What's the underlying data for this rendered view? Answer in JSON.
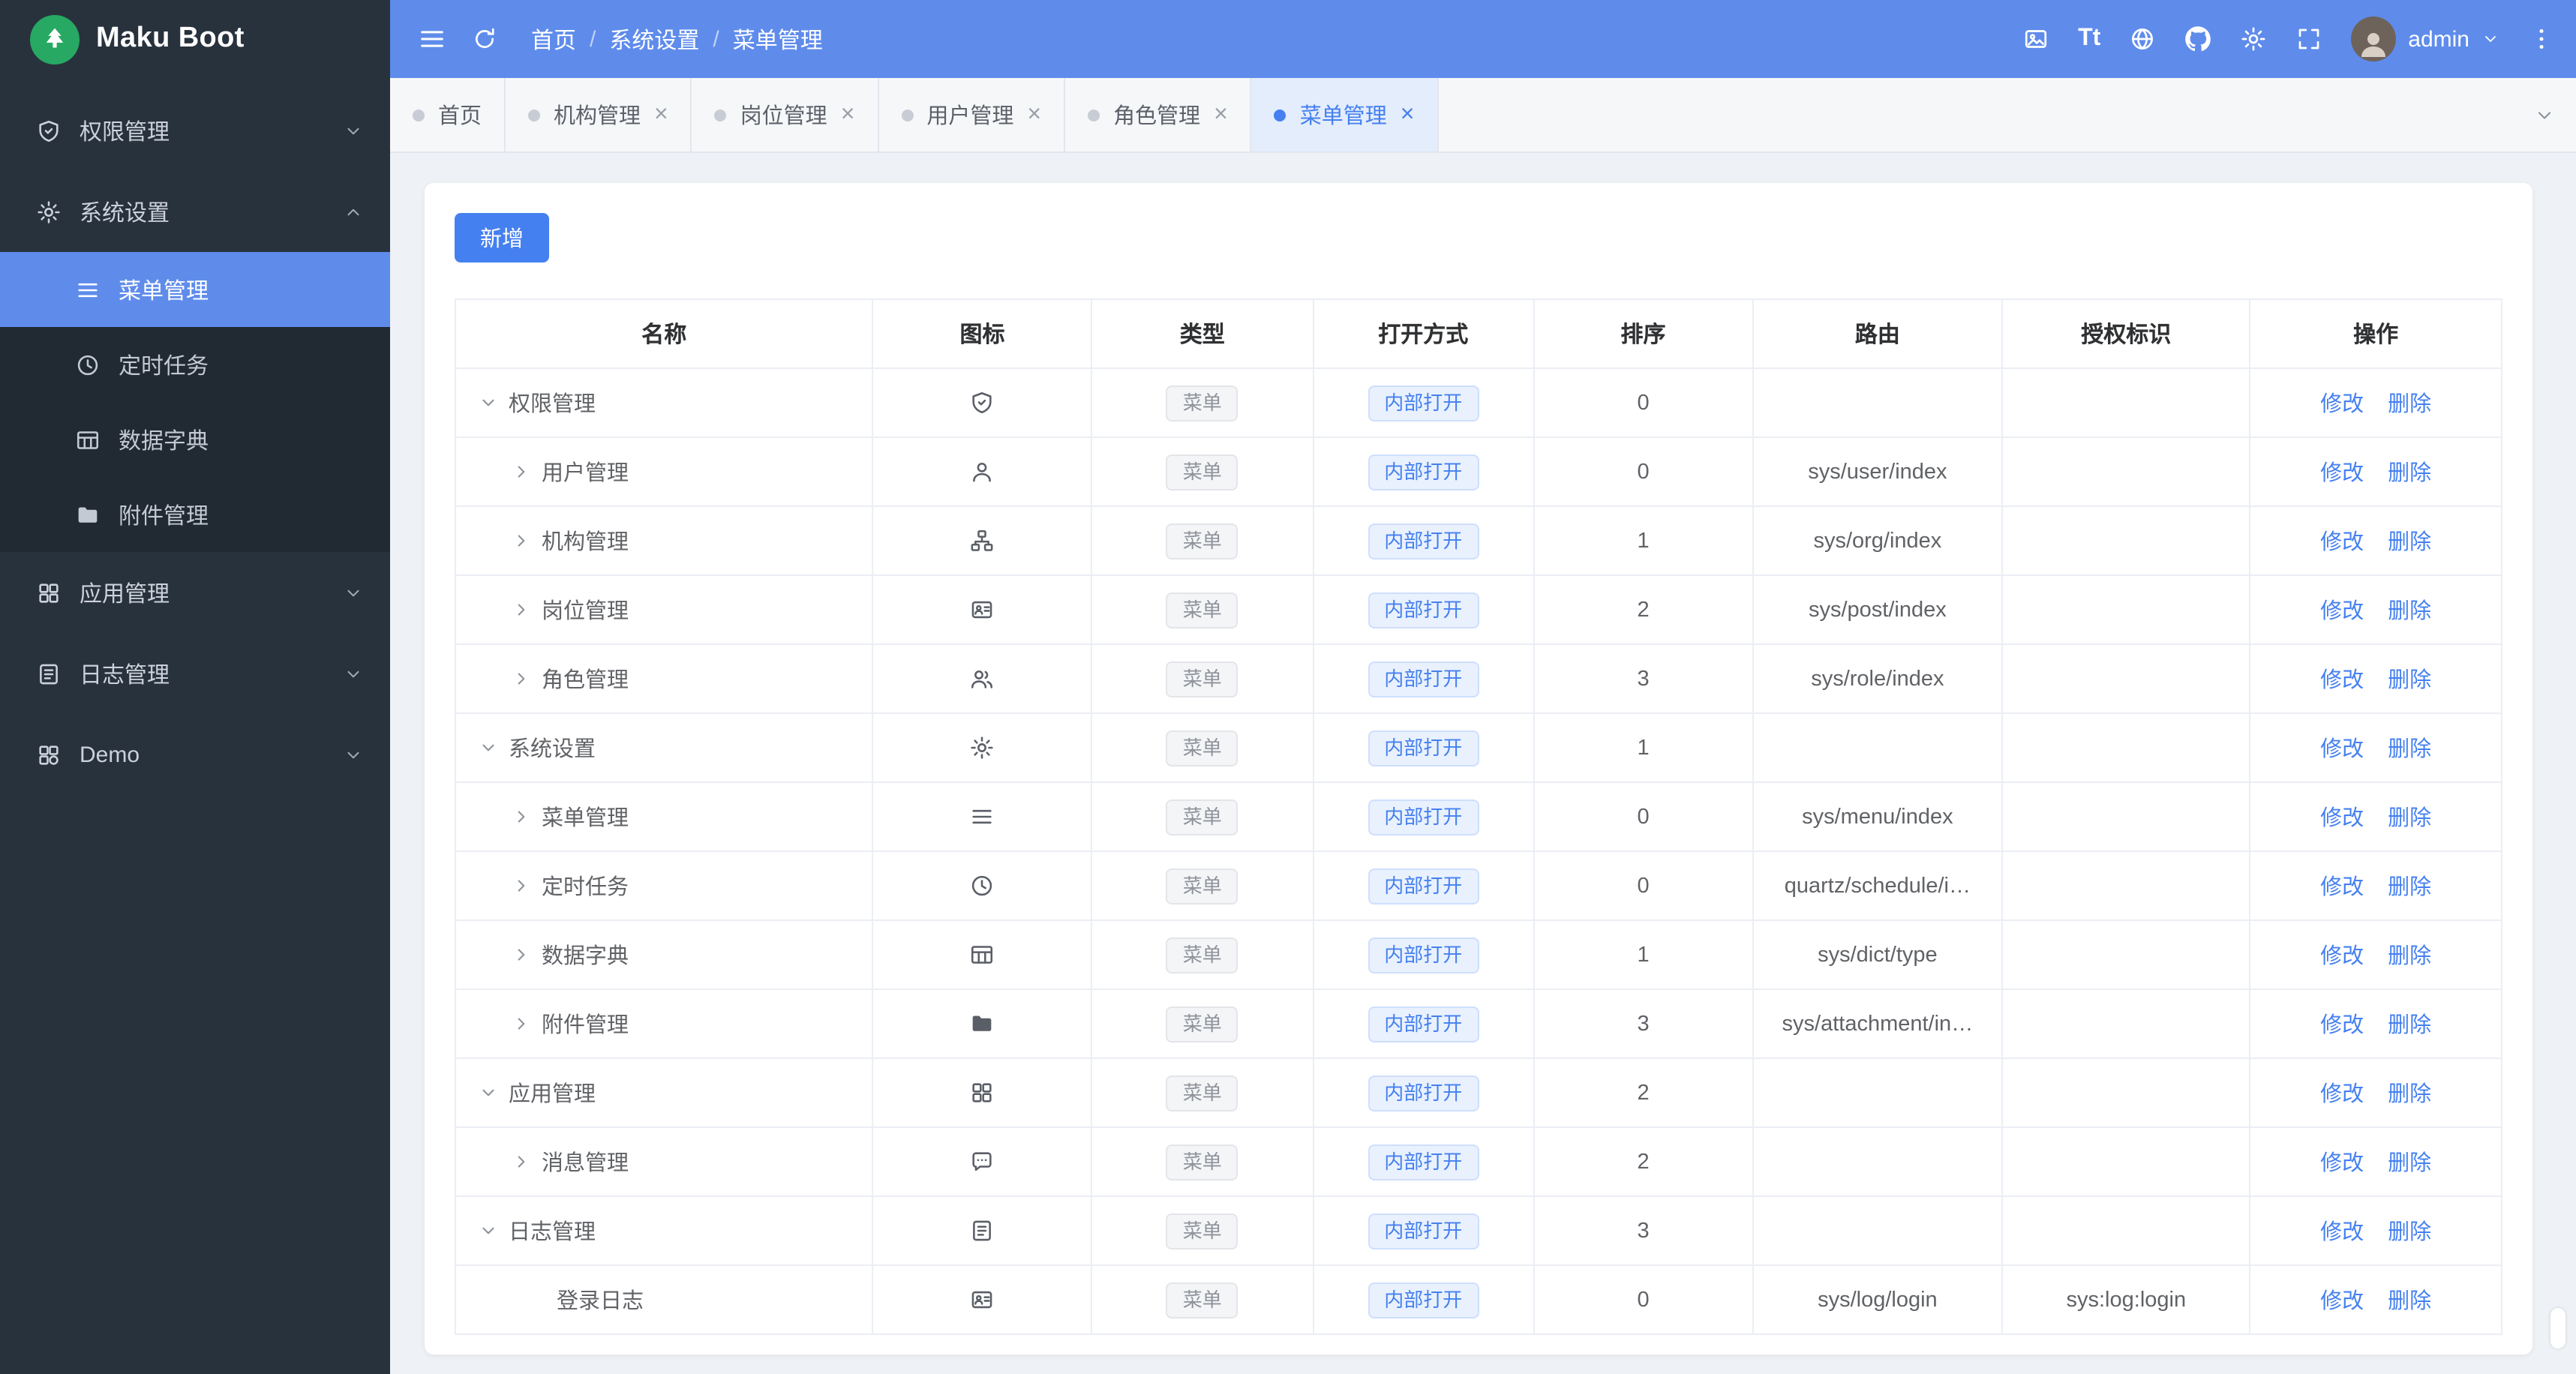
{
  "colors": {
    "header_bg": "#5f8ceb",
    "sidebar_bg": "#28323d",
    "sidebar_sub_bg": "#212a33",
    "sidebar_active_bg": "#5f8ceb",
    "primary": "#4580f0",
    "logo_green": "#27a863",
    "page_bg": "#eef1f5",
    "active_tab_bg": "#e3edfc",
    "tag_info_bg": "#f4f5f7",
    "tag_info_text": "#8f939b",
    "tag_primary_bg": "#e9f1fe",
    "table_border": "#ebeef5"
  },
  "sidebar": {
    "logo_title": "Maku Boot",
    "items": [
      {
        "label": "权限管理",
        "icon": "shield-icon",
        "expanded": false
      },
      {
        "label": "系统设置",
        "icon": "gear-icon",
        "expanded": true,
        "children": [
          {
            "label": "菜单管理",
            "icon": "menu-icon",
            "active": true
          },
          {
            "label": "定时任务",
            "icon": "clock-icon",
            "active": false
          },
          {
            "label": "数据字典",
            "icon": "table-icon",
            "active": false
          },
          {
            "label": "附件管理",
            "icon": "folder-icon",
            "active": false
          }
        ]
      },
      {
        "label": "应用管理",
        "icon": "apps-icon",
        "expanded": false
      },
      {
        "label": "日志管理",
        "icon": "log-icon",
        "expanded": false
      },
      {
        "label": "Demo",
        "icon": "demo-icon",
        "expanded": false
      }
    ]
  },
  "header": {
    "breadcrumb": [
      "首页",
      "系统设置",
      "菜单管理"
    ],
    "font_icon_label": "Tt",
    "user": "admin"
  },
  "tabs": [
    {
      "label": "首页",
      "closable": false,
      "active": false
    },
    {
      "label": "机构管理",
      "closable": true,
      "active": false
    },
    {
      "label": "岗位管理",
      "closable": true,
      "active": false
    },
    {
      "label": "用户管理",
      "closable": true,
      "active": false
    },
    {
      "label": "角色管理",
      "closable": true,
      "active": false
    },
    {
      "label": "菜单管理",
      "closable": true,
      "active": true
    }
  ],
  "toolbar": {
    "add_label": "新增"
  },
  "table": {
    "headers": [
      "名称",
      "图标",
      "类型",
      "打开方式",
      "排序",
      "路由",
      "授权标识",
      "操作"
    ],
    "ops": [
      "修改",
      "删除"
    ],
    "rows": [
      {
        "name": "权限管理",
        "icon": "shield-icon",
        "arrow": "down",
        "level": 0,
        "type": "菜单",
        "open": "内部打开",
        "sort": "0",
        "route": "",
        "auth": ""
      },
      {
        "name": "用户管理",
        "icon": "user-icon",
        "arrow": "right",
        "level": 1,
        "type": "菜单",
        "open": "内部打开",
        "sort": "0",
        "route": "sys/user/index",
        "auth": ""
      },
      {
        "name": "机构管理",
        "icon": "org-icon",
        "arrow": "right",
        "level": 1,
        "type": "菜单",
        "open": "内部打开",
        "sort": "1",
        "route": "sys/org/index",
        "auth": ""
      },
      {
        "name": "岗位管理",
        "icon": "badge-icon",
        "arrow": "right",
        "level": 1,
        "type": "菜单",
        "open": "内部打开",
        "sort": "2",
        "route": "sys/post/index",
        "auth": ""
      },
      {
        "name": "角色管理",
        "icon": "role-icon",
        "arrow": "right",
        "level": 1,
        "type": "菜单",
        "open": "内部打开",
        "sort": "3",
        "route": "sys/role/index",
        "auth": ""
      },
      {
        "name": "系统设置",
        "icon": "gear-icon",
        "arrow": "down",
        "level": 0,
        "type": "菜单",
        "open": "内部打开",
        "sort": "1",
        "route": "",
        "auth": ""
      },
      {
        "name": "菜单管理",
        "icon": "menu-icon",
        "arrow": "right",
        "level": 1,
        "type": "菜单",
        "open": "内部打开",
        "sort": "0",
        "route": "sys/menu/index",
        "auth": ""
      },
      {
        "name": "定时任务",
        "icon": "clock-icon",
        "arrow": "right",
        "level": 1,
        "type": "菜单",
        "open": "内部打开",
        "sort": "0",
        "route": "quartz/schedule/i…",
        "auth": ""
      },
      {
        "name": "数据字典",
        "icon": "table-icon",
        "arrow": "right",
        "level": 1,
        "type": "菜单",
        "open": "内部打开",
        "sort": "1",
        "route": "sys/dict/type",
        "auth": ""
      },
      {
        "name": "附件管理",
        "icon": "folder-icon",
        "arrow": "right",
        "level": 1,
        "type": "菜单",
        "open": "内部打开",
        "sort": "3",
        "route": "sys/attachment/in…",
        "auth": ""
      },
      {
        "name": "应用管理",
        "icon": "apps-icon",
        "arrow": "down",
        "level": 0,
        "type": "菜单",
        "open": "内部打开",
        "sort": "2",
        "route": "",
        "auth": ""
      },
      {
        "name": "消息管理",
        "icon": "message-icon",
        "arrow": "right",
        "level": 1,
        "type": "菜单",
        "open": "内部打开",
        "sort": "2",
        "route": "",
        "auth": ""
      },
      {
        "name": "日志管理",
        "icon": "log-icon",
        "arrow": "down",
        "level": 0,
        "type": "菜单",
        "open": "内部打开",
        "sort": "3",
        "route": "",
        "auth": ""
      },
      {
        "name": "登录日志",
        "icon": "badge-icon",
        "arrow": "none",
        "level": 2,
        "type": "菜单",
        "open": "内部打开",
        "sort": "0",
        "route": "sys/log/login",
        "auth": "sys:log:login"
      }
    ]
  }
}
